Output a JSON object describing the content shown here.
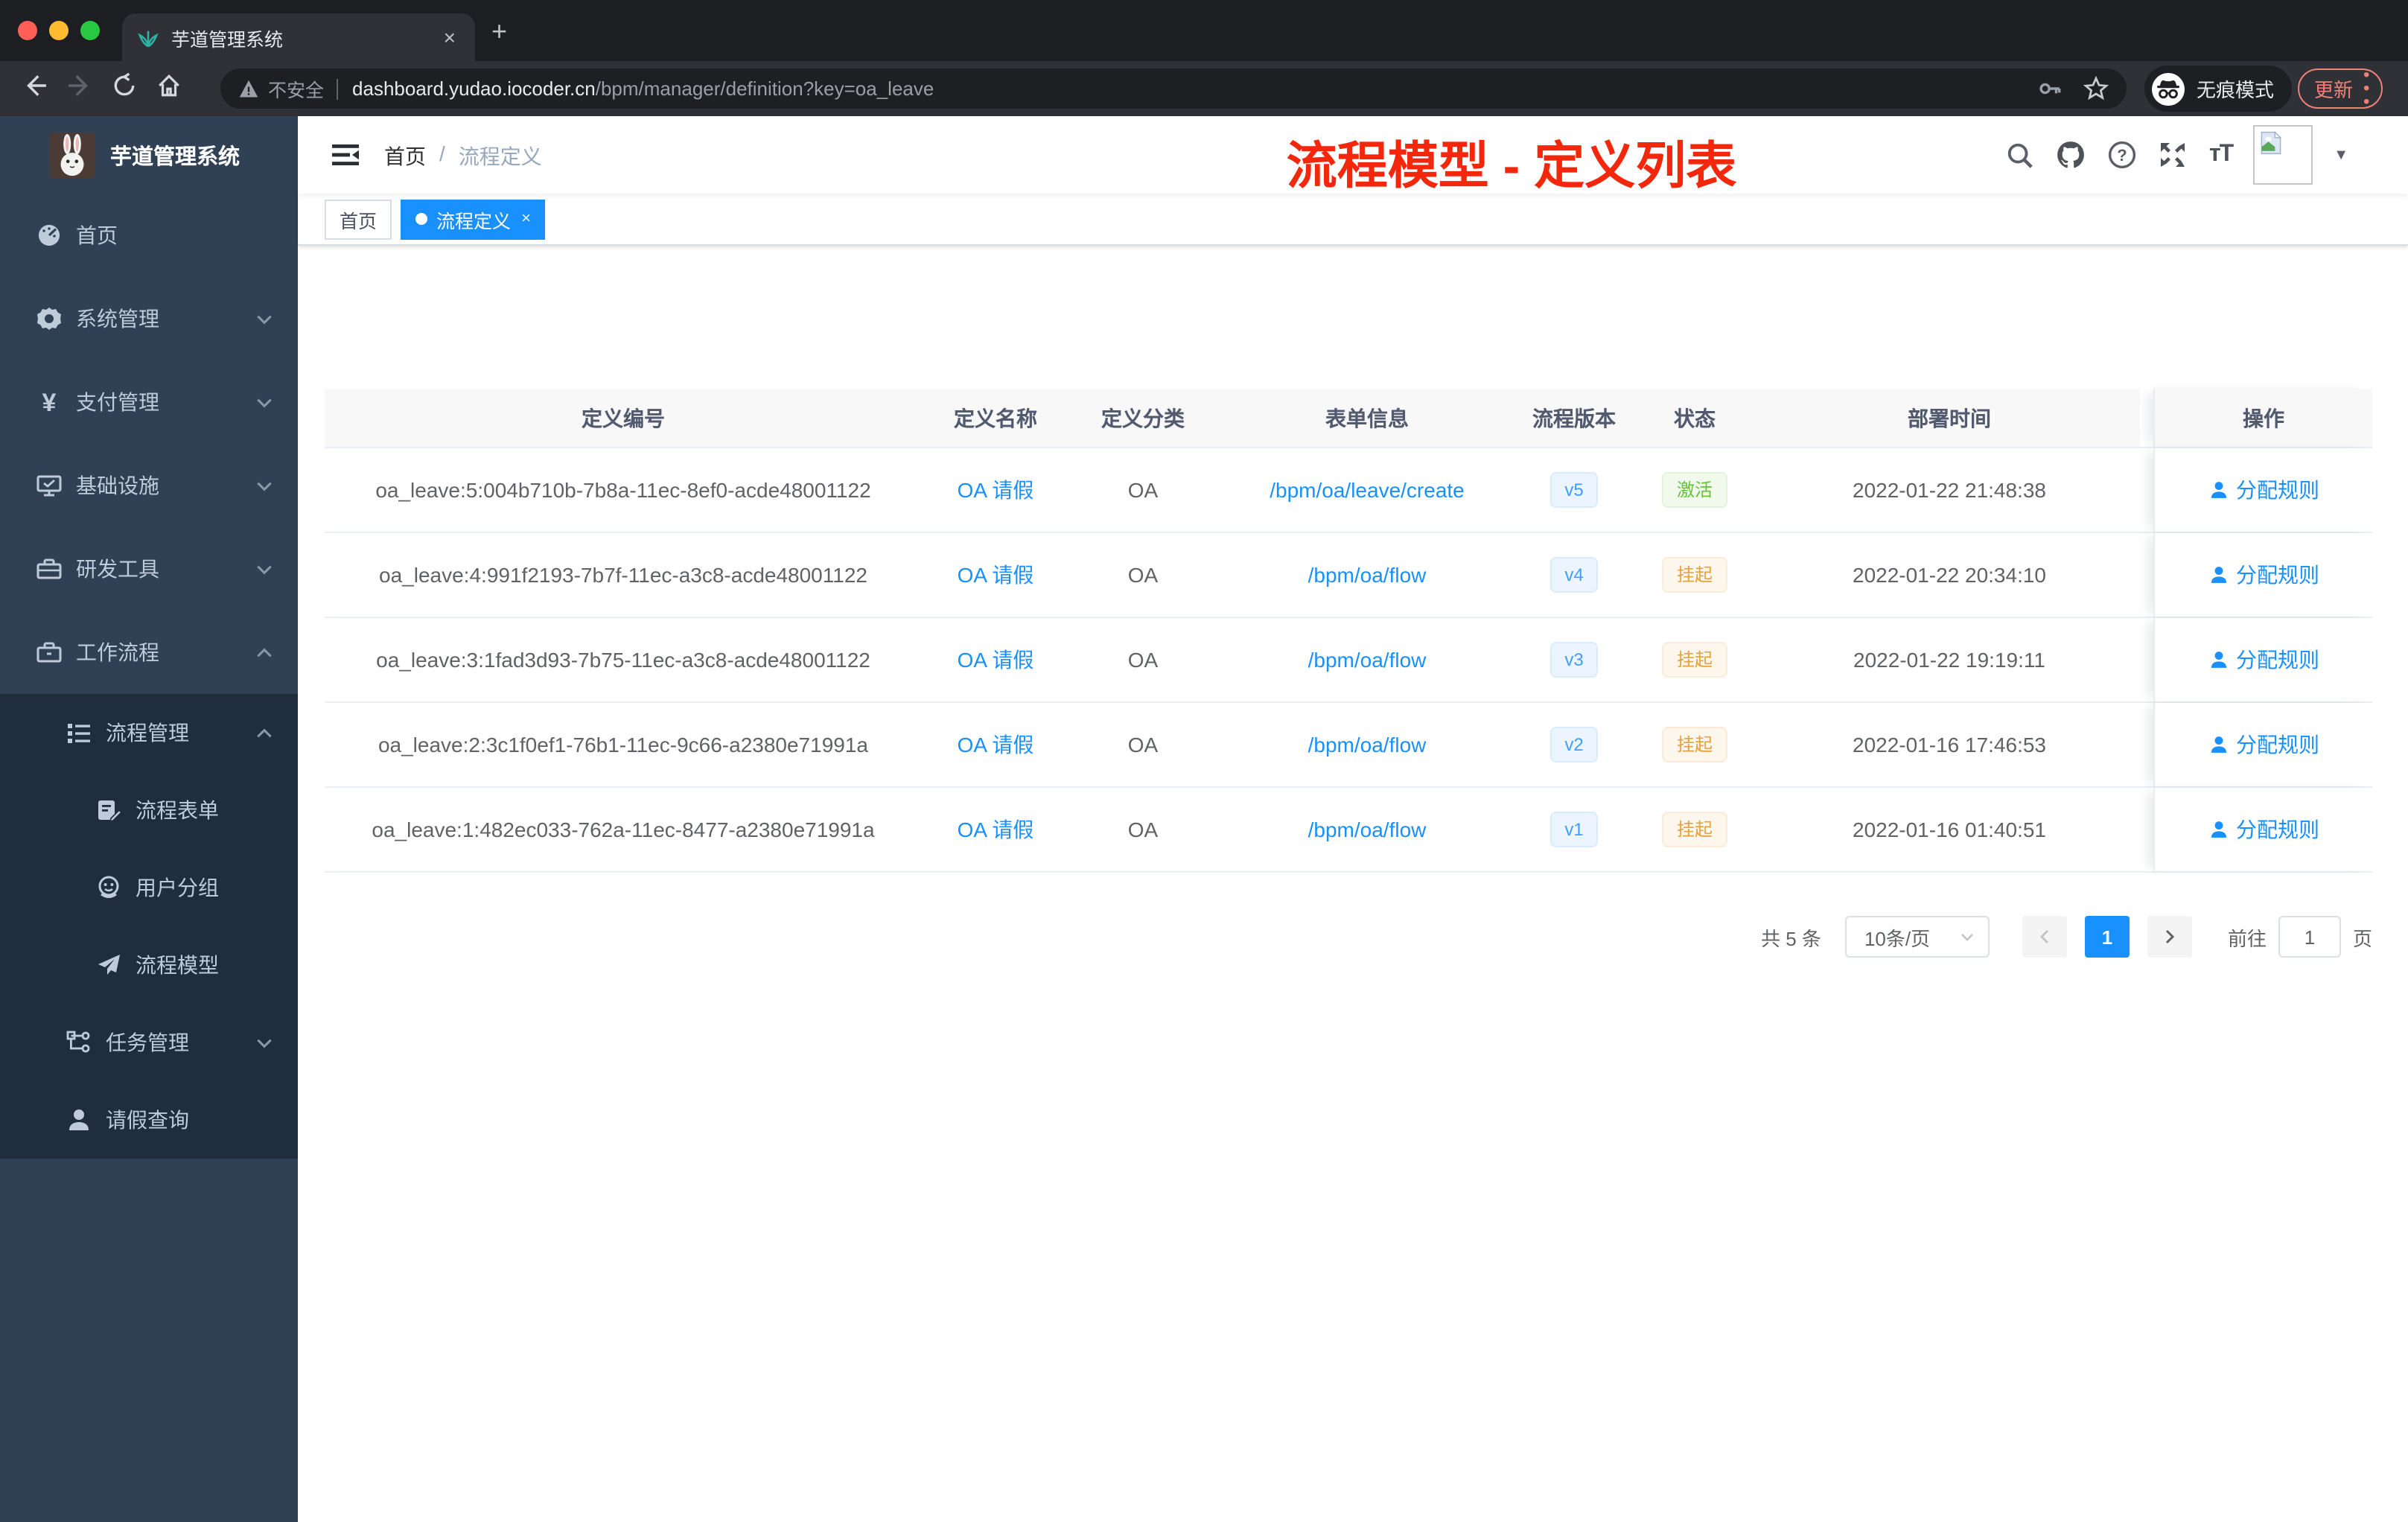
{
  "browser": {
    "tab_title": "芋道管理系统",
    "new_tab_label": "+",
    "close_tab_label": "×",
    "security_label": "不安全",
    "url_host": "dashboard.yudao.iocoder.cn",
    "url_path": "/bpm/manager/definition?key=oa_leave",
    "incognito_label": "无痕模式",
    "update_label": "更新",
    "icons": [
      "back-icon",
      "forward-icon",
      "reload-icon",
      "home-icon",
      "warning-icon",
      "key-icon",
      "star-icon",
      "incognito-icon",
      "menu-dots-icon"
    ]
  },
  "sidebar": {
    "logo_title": "芋道管理系统",
    "items": [
      {
        "key": "home",
        "label": "首页",
        "icon": "dashboard",
        "level": 1,
        "arrow": "",
        "dark": false
      },
      {
        "key": "system",
        "label": "系统管理",
        "icon": "gear",
        "level": 1,
        "arrow": "down",
        "dark": false
      },
      {
        "key": "payment",
        "label": "支付管理",
        "icon": "yen",
        "level": 1,
        "arrow": "down",
        "dark": false
      },
      {
        "key": "infrastructure",
        "label": "基础设施",
        "icon": "monitor",
        "level": 1,
        "arrow": "down",
        "dark": false
      },
      {
        "key": "dev-tools",
        "label": "研发工具",
        "icon": "toolbox",
        "level": 1,
        "arrow": "down",
        "dark": false
      },
      {
        "key": "workflow",
        "label": "工作流程",
        "icon": "briefcase",
        "level": 1,
        "arrow": "up",
        "dark": false
      },
      {
        "key": "process-management",
        "label": "流程管理",
        "icon": "list",
        "level": 2,
        "arrow": "up",
        "dark": true
      },
      {
        "key": "process-form",
        "label": "流程表单",
        "icon": "form",
        "level": 3,
        "arrow": "",
        "dark": true
      },
      {
        "key": "user-group",
        "label": "用户分组",
        "icon": "people",
        "level": 3,
        "arrow": "",
        "dark": true
      },
      {
        "key": "process-model",
        "label": "流程模型",
        "icon": "send",
        "level": 3,
        "arrow": "",
        "dark": true
      },
      {
        "key": "task-management",
        "label": "任务管理",
        "icon": "tree",
        "level": 2,
        "arrow": "down",
        "dark": true
      },
      {
        "key": "leave-query",
        "label": "请假查询",
        "icon": "user",
        "level": 2,
        "arrow": "",
        "dark": true
      }
    ]
  },
  "header": {
    "breadcrumb": [
      "首页",
      "流程定义"
    ],
    "breadcrumb_separator": "/",
    "annotation": "流程模型 - 定义列表",
    "right_icons": [
      "search-icon",
      "github-icon",
      "question-icon",
      "fullscreen-icon",
      "font-size-icon",
      "avatar",
      "dropdown-caret-icon"
    ]
  },
  "tags": [
    {
      "key": "home",
      "label": "首页",
      "active": false
    },
    {
      "key": "process-definition",
      "label": "流程定义",
      "active": true,
      "close": "×"
    }
  ],
  "table": {
    "columns": [
      "定义编号",
      "定义名称",
      "定义分类",
      "表单信息",
      "流程版本",
      "状态",
      "部署时间",
      "操作"
    ],
    "column_keys": [
      "definition-id",
      "definition-name",
      "definition-category",
      "form-info",
      "process-version",
      "status",
      "deploy-time",
      "actions"
    ],
    "rows": [
      {
        "id": "oa_leave:5:004b710b-7b8a-11ec-8ef0-acde48001122",
        "name": "OA 请假",
        "category": "OA",
        "form": "/bpm/oa/leave/create",
        "version": "v5",
        "status": "激活",
        "status_type": "success",
        "time": "2022-01-22 21:48:38",
        "action": "分配规则"
      },
      {
        "id": "oa_leave:4:991f2193-7b7f-11ec-a3c8-acde48001122",
        "name": "OA 请假",
        "category": "OA",
        "form": "/bpm/oa/flow",
        "version": "v4",
        "status": "挂起",
        "status_type": "warning",
        "time": "2022-01-22 20:34:10",
        "action": "分配规则"
      },
      {
        "id": "oa_leave:3:1fad3d93-7b75-11ec-a3c8-acde48001122",
        "name": "OA 请假",
        "category": "OA",
        "form": "/bpm/oa/flow",
        "version": "v3",
        "status": "挂起",
        "status_type": "warning",
        "time": "2022-01-22 19:19:11",
        "action": "分配规则"
      },
      {
        "id": "oa_leave:2:3c1f0ef1-76b1-11ec-9c66-a2380e71991a",
        "name": "OA 请假",
        "category": "OA",
        "form": "/bpm/oa/flow",
        "version": "v2",
        "status": "挂起",
        "status_type": "warning",
        "time": "2022-01-16 17:46:53",
        "action": "分配规则"
      },
      {
        "id": "oa_leave:1:482ec033-762a-11ec-8477-a2380e71991a",
        "name": "OA 请假",
        "category": "OA",
        "form": "/bpm/oa/flow",
        "version": "v1",
        "status": "挂起",
        "status_type": "warning",
        "time": "2022-01-16 01:40:51",
        "action": "分配规则"
      }
    ]
  },
  "pagination": {
    "total": "共 5 条",
    "page_size": "10条/页",
    "current_page": "1",
    "goto_label": "前往",
    "goto_value": "1",
    "page_unit": "页"
  },
  "colors": {
    "accent_blue": "#1890fe",
    "tag_blue_text": "#409eff",
    "success_green": "#67c23a",
    "warning_orange": "#e6a23c",
    "annotation_red": "#f2270c",
    "sidebar_bg": "#304156",
    "sidebar_submenu_bg": "#1f2d3d",
    "active_tag_bg": "#1890fe"
  }
}
